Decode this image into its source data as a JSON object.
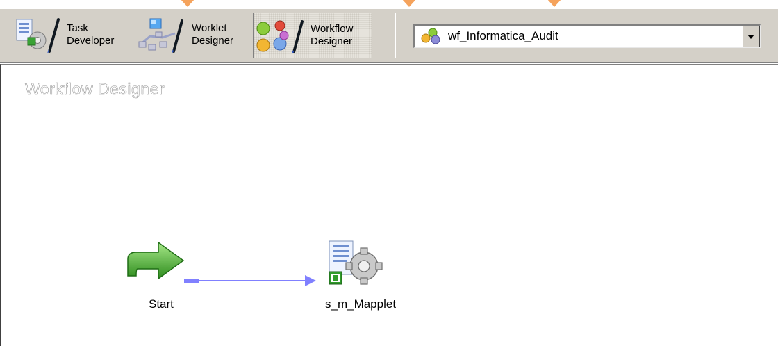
{
  "toolbar": {
    "buttons": [
      {
        "label": "Task\nDeveloper",
        "icon": "task-developer-icon"
      },
      {
        "label": "Worklet\nDesigner",
        "icon": "worklet-designer-icon"
      },
      {
        "label": "Workflow\nDesigner",
        "icon": "workflow-designer-icon",
        "active": true
      }
    ],
    "workflow_select": {
      "value": "wf_Informatica_Audit",
      "icon": "workflow-icon"
    }
  },
  "canvas": {
    "title": "Workflow Designer",
    "nodes": [
      {
        "label": "Start",
        "icon": "start-arrow-icon"
      },
      {
        "label": "s_m_Mapplet",
        "icon": "session-gear-icon"
      }
    ],
    "link": {
      "from": "Start",
      "to": "s_m_Mapplet",
      "color": "#8080ff"
    }
  },
  "colors": {
    "toolbar_bg": "#d4d0c8",
    "link": "#8080ff",
    "start_green": "#3fae2a"
  }
}
